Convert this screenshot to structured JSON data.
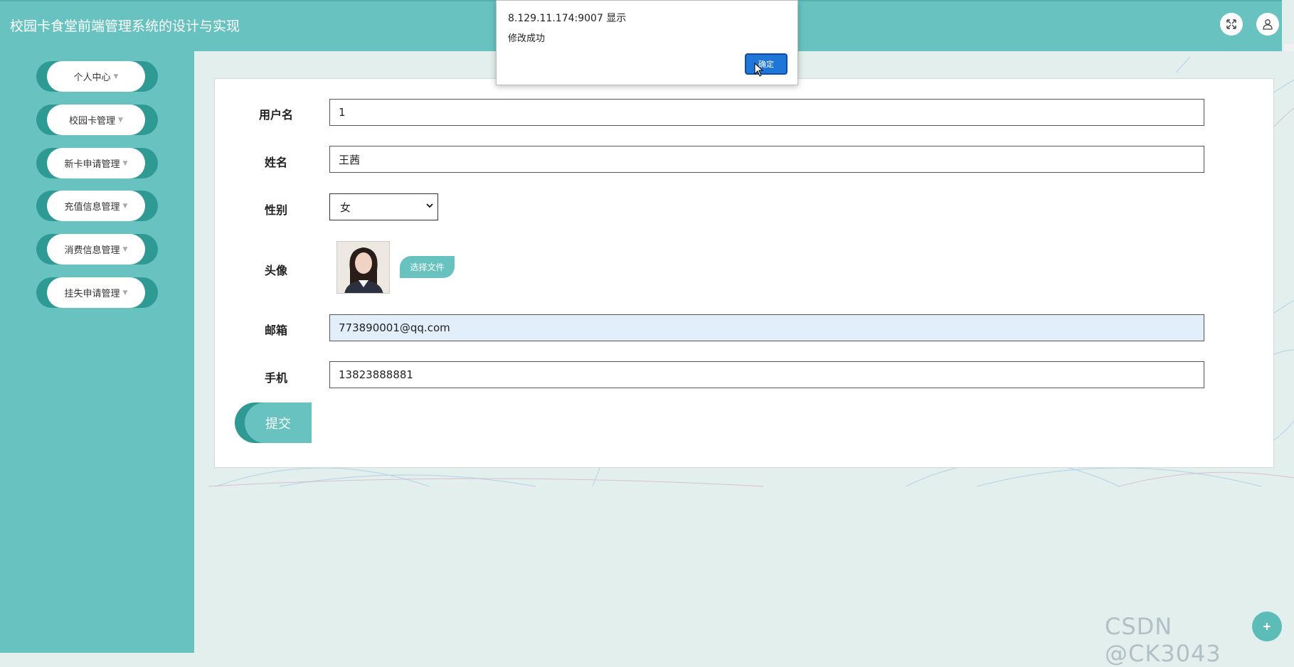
{
  "app": {
    "title": "校园卡食堂前端管理系统的设计与实现"
  },
  "topbar": {
    "icons": [
      "fullscreen-icon",
      "user-icon"
    ]
  },
  "sidebar": {
    "items": [
      {
        "label": "个人中心"
      },
      {
        "label": "校园卡管理"
      },
      {
        "label": "新卡申请管理"
      },
      {
        "label": "充值信息管理"
      },
      {
        "label": "消费信息管理"
      },
      {
        "label": "挂失申请管理"
      }
    ]
  },
  "form": {
    "username": {
      "label": "用户名",
      "value": "1"
    },
    "name": {
      "label": "姓名",
      "value": "王茜"
    },
    "gender": {
      "label": "性别",
      "value": "女"
    },
    "avatar": {
      "label": "头像",
      "button": "选择文件"
    },
    "email": {
      "label": "邮箱",
      "value": "773890001@qq.com"
    },
    "phone": {
      "label": "手机",
      "value": "13823888881"
    },
    "submit": "提交"
  },
  "dialog": {
    "origin": "8.129.11.174:9007 显示",
    "message": "修改成功",
    "ok": "确定"
  },
  "watermark": "CSDN @CK3043",
  "colors": {
    "primary": "#68c3c0",
    "accent": "#2f9a93",
    "dialog_button": "#1f75d8"
  }
}
